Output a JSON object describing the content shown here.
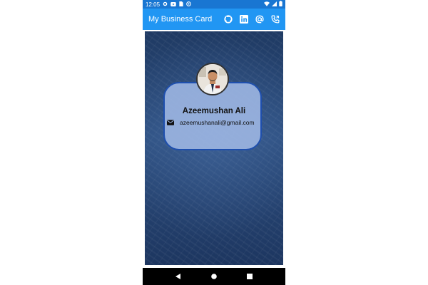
{
  "status_bar": {
    "time": "12:05",
    "left_icons": [
      "settings-icon",
      "youtube-icon",
      "sim-card-icon",
      "at-icon"
    ],
    "right_icons": [
      "wifi-icon",
      "signal-icon",
      "battery-icon"
    ]
  },
  "app_bar": {
    "title": "My Business Card",
    "actions": [
      "github-icon",
      "linkedin-icon",
      "at-icon",
      "phone-icon"
    ],
    "color": "#2196f3"
  },
  "card": {
    "name": "Azeemushan Ali",
    "email": "azeemushanali@gmail.com",
    "background": "#9bb4e1",
    "border_color": "#1e4fae"
  },
  "nav_bar": {
    "buttons": [
      "back-icon",
      "home-icon",
      "recents-icon"
    ]
  }
}
